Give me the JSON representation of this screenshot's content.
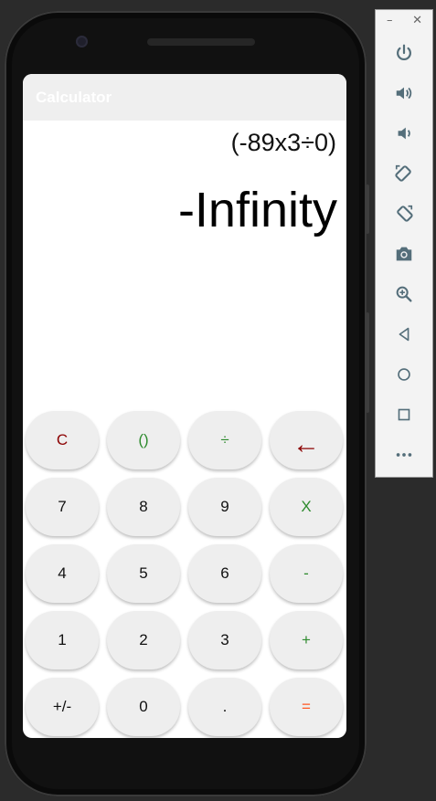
{
  "app": {
    "title": "Calculator"
  },
  "display": {
    "expression": "(-89x3÷0)",
    "result": "-Infinity"
  },
  "keypad": {
    "row1": [
      "C",
      "()",
      "÷",
      "←"
    ],
    "row2": [
      "7",
      "8",
      "9",
      "X"
    ],
    "row3": [
      "4",
      "5",
      "6",
      "-"
    ],
    "row4": [
      "1",
      "2",
      "3",
      "+"
    ],
    "row5": [
      "+/-",
      "0",
      ".",
      "="
    ]
  },
  "emulator": {
    "window_controls": {
      "minimize": "–",
      "close": "✕"
    },
    "tools": [
      "power-icon",
      "volume-up-icon",
      "volume-down-icon",
      "rotate-left-icon",
      "rotate-right-icon",
      "camera-icon",
      "zoom-icon",
      "back-icon",
      "home-icon",
      "overview-icon",
      "more-icon"
    ]
  },
  "colors": {
    "red_key": "#8b0000",
    "green_key": "#2e8b2e",
    "equals_key": "#ff5722",
    "key_bg": "#eeeeee",
    "toolbar_icon": "#546e7a"
  }
}
